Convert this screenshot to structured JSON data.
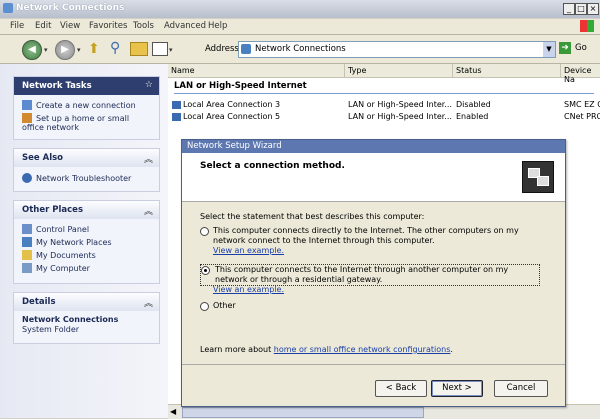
{
  "window": {
    "title": "Network Connections"
  },
  "menu": [
    "File",
    "Edit",
    "View",
    "Favorites",
    "Tools",
    "Advanced",
    "Help"
  ],
  "toolbar": {
    "address_label": "Address",
    "address_value": "Network Connections",
    "go_label": "Go"
  },
  "sidebar": {
    "network_tasks": {
      "title": "Network Tasks",
      "items": [
        "Create a new connection",
        "Set up a home or small office network"
      ]
    },
    "see_also": {
      "title": "See Also",
      "items": [
        "Network Troubleshooter"
      ]
    },
    "other_places": {
      "title": "Other Places",
      "items": [
        "Control Panel",
        "My Network Places",
        "My Documents",
        "My Computer"
      ]
    },
    "details": {
      "title": "Details",
      "name": "Network Connections",
      "type": "System Folder"
    }
  },
  "list": {
    "columns": [
      "Name",
      "Type",
      "Status",
      "Device Na"
    ],
    "group": "LAN or High-Speed Internet",
    "rows": [
      {
        "name": "Local Area Connection 3",
        "type": "LAN or High-Speed Inter...",
        "status": "Disabled",
        "device": "SMC EZ C"
      },
      {
        "name": "Local Area Connection 5",
        "type": "LAN or High-Speed Inter...",
        "status": "Enabled",
        "device": "CNet PRO"
      }
    ]
  },
  "wizard": {
    "title": "Network Setup Wizard",
    "heading": "Select a connection method.",
    "prompt": "Select the statement that best describes this computer:",
    "options": [
      {
        "text": "This computer connects directly to the Internet. The other computers on my network connect to the Internet through this computer.",
        "link": "View an example.",
        "selected": false
      },
      {
        "text": "This computer connects to the Internet through another computer on my network or through a residential gateway.",
        "link": "View an example.",
        "selected": true
      },
      {
        "text": "Other",
        "link": "",
        "selected": false
      }
    ],
    "learn_prefix": "Learn more about",
    "learn_link": "home or small office network configurations",
    "learn_suffix": ".",
    "buttons": {
      "back": "< Back",
      "next": "Next >",
      "cancel": "Cancel"
    }
  }
}
